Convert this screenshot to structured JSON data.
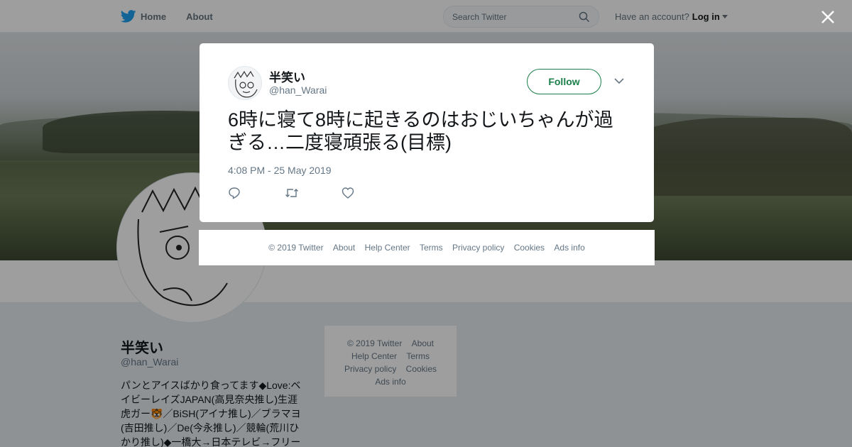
{
  "nav": {
    "home_label": "Home",
    "about_label": "About",
    "search_placeholder": "Search Twitter",
    "account_prompt": "Have an account?",
    "login_label": "Log in"
  },
  "profile": {
    "name": "半笑い",
    "handle": "@han_Warai",
    "bio": "パンとアイスばかり食ってます◆Love:ベイビーレイズJAPAN(高見奈央推し)生涯虎ガー🐯／BiSH(アイナ推し)／ブラマヨ(吉田推し)／De(今永推し)／競輪(荒川ひかり推し)◆一橋大→日本テレビ→フリー"
  },
  "sidebar_footer": {
    "items": [
      "© 2019 Twitter",
      "About",
      "Help Center",
      "Terms",
      "Privacy policy",
      "Cookies",
      "Ads info"
    ]
  },
  "tweet": {
    "author_name": "半笑い",
    "author_handle": "@han_Warai",
    "follow_label": "Follow",
    "text": "6時に寝て8時に起きるのはおじいちゃんが過ぎる…二度寝頑張る(目標)",
    "timestamp": "4:08 PM - 25 May 2019"
  },
  "modal_footer": {
    "items": [
      "© 2019 Twitter",
      "About",
      "Help Center",
      "Terms",
      "Privacy policy",
      "Cookies",
      "Ads info"
    ]
  },
  "colors": {
    "twitter_blue": "#1da1f2",
    "follow_green": "#1b7f4a",
    "muted_text": "#657786"
  },
  "icons": [
    "twitter-bird-icon",
    "search-icon",
    "close-icon",
    "chevron-down-icon",
    "reply-icon",
    "retweet-icon",
    "like-icon"
  ]
}
